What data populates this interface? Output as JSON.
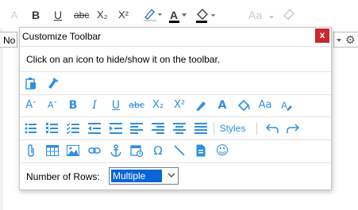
{
  "background_toolbar": {
    "font_size_up": "A",
    "bold": "B",
    "underline": "U",
    "strikethrough": "abc",
    "subscript": "X₂",
    "superscript": "X²",
    "text_color": "A",
    "change_case": "Aa",
    "font_select_value": "No"
  },
  "dialog": {
    "title": "Customize Toolbar",
    "close_label": "x",
    "instruction": "Click on an icon to hide/show it on the toolbar.",
    "row2": {
      "bold": "B",
      "italic": "I",
      "underline": "U",
      "strikethrough": "abc",
      "subscript": "X₂",
      "superscript": "X²",
      "font_color": "A",
      "change_case": "Aa"
    },
    "row3": {
      "styles_label": "Styles"
    },
    "row4": {
      "special_char": "Ω",
      "emoji": "☺"
    },
    "rows_label": "Number of Rows:",
    "rows_value": "Multiple"
  },
  "colors": {
    "icon_blue": "#2f8fde",
    "close_red": "#c8282e",
    "selection_blue": "#0a64d6"
  }
}
